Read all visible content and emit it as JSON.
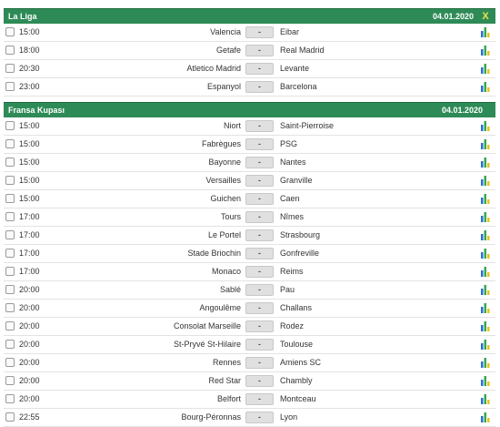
{
  "sections": [
    {
      "title": "La Liga",
      "date": "04.01.2020",
      "close_label": "X",
      "matches": [
        {
          "time": "15:00",
          "home": "Valencia",
          "score": "-",
          "away": "Eibar"
        },
        {
          "time": "18:00",
          "home": "Getafe",
          "score": "-",
          "away": "Real Madrid"
        },
        {
          "time": "20:30",
          "home": "Atletico Madrid",
          "score": "-",
          "away": "Levante"
        },
        {
          "time": "23:00",
          "home": "Espanyol",
          "score": "-",
          "away": "Barcelona"
        }
      ]
    },
    {
      "title": "Fransa Kupası",
      "date": "04.01.2020",
      "matches": [
        {
          "time": "15:00",
          "home": "Niort",
          "score": "-",
          "away": "Saint-Pierroise"
        },
        {
          "time": "15:00",
          "home": "Fabrègues",
          "score": "-",
          "away": "PSG"
        },
        {
          "time": "15:00",
          "home": "Bayonne",
          "score": "-",
          "away": "Nantes"
        },
        {
          "time": "15:00",
          "home": "Versailles",
          "score": "-",
          "away": "Granville"
        },
        {
          "time": "15:00",
          "home": "Guichen",
          "score": "-",
          "away": "Caen"
        },
        {
          "time": "17:00",
          "home": "Tours",
          "score": "-",
          "away": "Nîmes"
        },
        {
          "time": "17:00",
          "home": "Le Portel",
          "score": "-",
          "away": "Strasbourg"
        },
        {
          "time": "17:00",
          "home": "Stade Briochin",
          "score": "-",
          "away": "Gonfreville"
        },
        {
          "time": "17:00",
          "home": "Monaco",
          "score": "-",
          "away": "Reims"
        },
        {
          "time": "20:00",
          "home": "Sablé",
          "score": "-",
          "away": "Pau"
        },
        {
          "time": "20:00",
          "home": "Angoulême",
          "score": "-",
          "away": "Challans"
        },
        {
          "time": "20:00",
          "home": "Consolat Marseille",
          "score": "-",
          "away": "Rodez"
        },
        {
          "time": "20:00",
          "home": "St-Pryvé St-Hilaire",
          "score": "-",
          "away": "Toulouse"
        },
        {
          "time": "20:00",
          "home": "Rennes",
          "score": "-",
          "away": "Amiens SC"
        },
        {
          "time": "20:00",
          "home": "Red Star",
          "score": "-",
          "away": "Chambly"
        },
        {
          "time": "20:00",
          "home": "Belfort",
          "score": "-",
          "away": "Montceau"
        },
        {
          "time": "22:55",
          "home": "Bourg-Péronnas",
          "score": "-",
          "away": "Lyon"
        }
      ]
    }
  ],
  "icons": {
    "stats": "bar-chart-icon",
    "checkbox": "checkbox-icon"
  },
  "colors": {
    "header_bg": "#2e8b57",
    "close_x": "#f0e14a",
    "stats_bars": [
      "#2a6fd6",
      "#36a852",
      "#e8c21a"
    ]
  }
}
